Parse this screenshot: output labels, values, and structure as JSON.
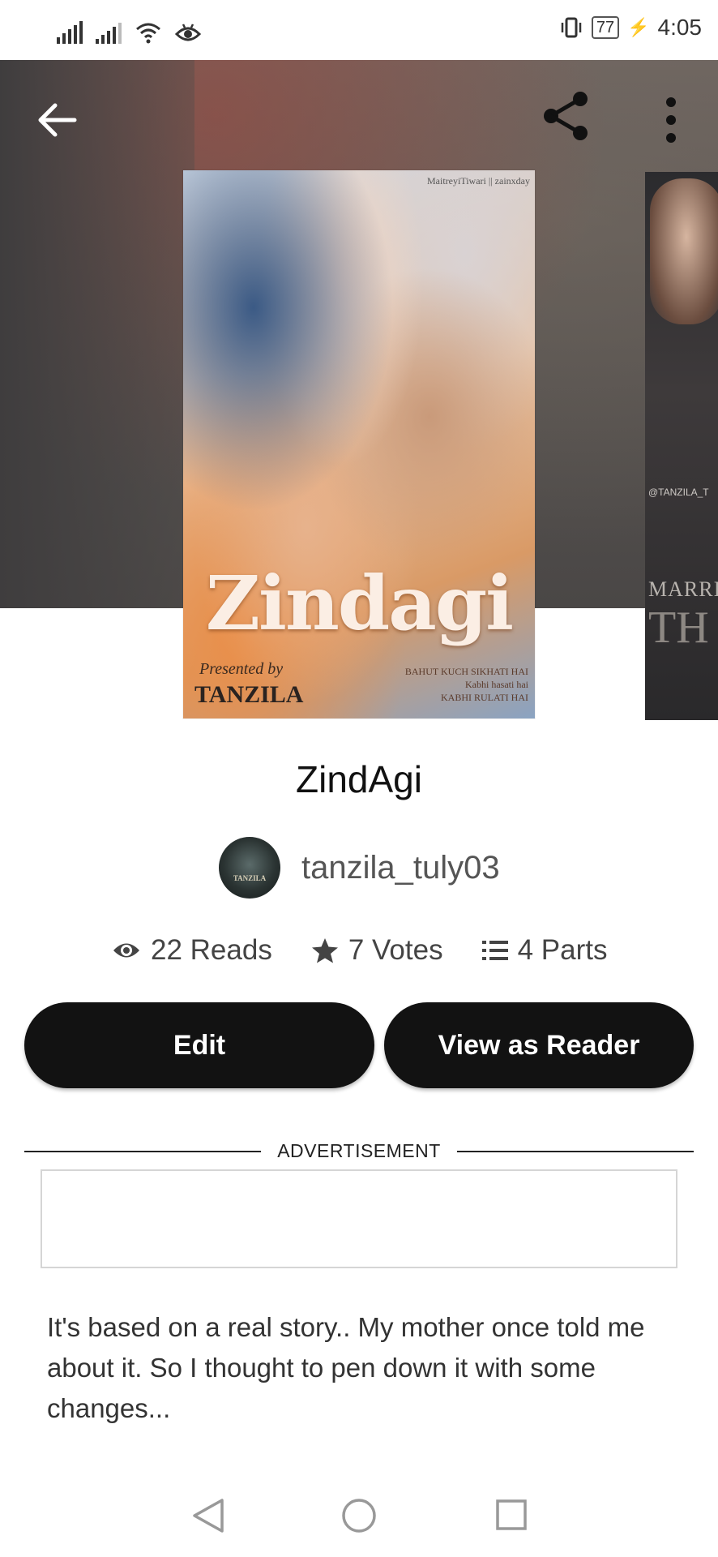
{
  "status_bar": {
    "time": "4:05",
    "battery": "77"
  },
  "header": {
    "back_icon": "arrow-left-icon",
    "share_icon": "share-icon",
    "more_icon": "more-vertical-icon"
  },
  "cover": {
    "credit": "MaitreyiTiwari || zainxday",
    "title": "Zindagi",
    "presented_by": "Presented by",
    "author": "TANZILA",
    "tagline_1": "BAHUT KUCH SIKHATI HAI",
    "tagline_2": "Kabhi hasati hai",
    "tagline_3": "KABHI RULATI HAI"
  },
  "next_cover": {
    "small_text": "@TANZILA_T",
    "text_1": "MARRI",
    "text_2": "TH"
  },
  "story": {
    "title": "ZindAgi",
    "author": "tanzila_tuly03",
    "avatar_text": "TANZILA"
  },
  "stats": {
    "reads": "22 Reads",
    "votes": "7 Votes",
    "parts": "4 Parts"
  },
  "actions": {
    "edit": "Edit",
    "view_as_reader": "View as Reader"
  },
  "advertisement": {
    "label": "ADVERTISEMENT"
  },
  "description": {
    "text": "It's based on a real story.. My mother once told me about it. So I thought to pen down it with some changes..."
  },
  "colors": {
    "button_bg": "#121212",
    "button_text": "#ffffff",
    "text_primary": "#111111",
    "text_secondary": "#555555"
  }
}
